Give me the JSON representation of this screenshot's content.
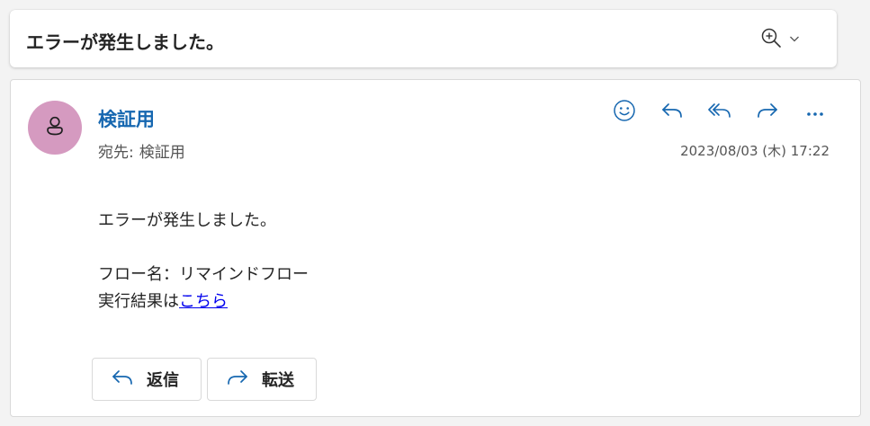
{
  "subject": {
    "title": "エラーが発生しました。",
    "zoom_icon": "zoom-in-icon",
    "chevron_icon": "chevron-down-icon"
  },
  "message": {
    "sender_name": "検証用",
    "to_label": "宛先:",
    "to_name": "検証用",
    "datetime": "2023/08/03 (木) 17:22",
    "avatar_color": "#d59ac0",
    "accent_color": "#1667b0",
    "actions": [
      {
        "icon": "smiley-icon"
      },
      {
        "icon": "reply-icon"
      },
      {
        "icon": "reply-all-icon"
      },
      {
        "icon": "forward-icon"
      },
      {
        "icon": "more-icon"
      }
    ],
    "body": {
      "line1": "エラーが発生しました。",
      "line2": "フロー名：リマインドフロー",
      "line3_prefix": "実行結果は",
      "line3_link": "こちら"
    }
  },
  "footer": {
    "reply_label": "返信",
    "forward_label": "転送"
  }
}
